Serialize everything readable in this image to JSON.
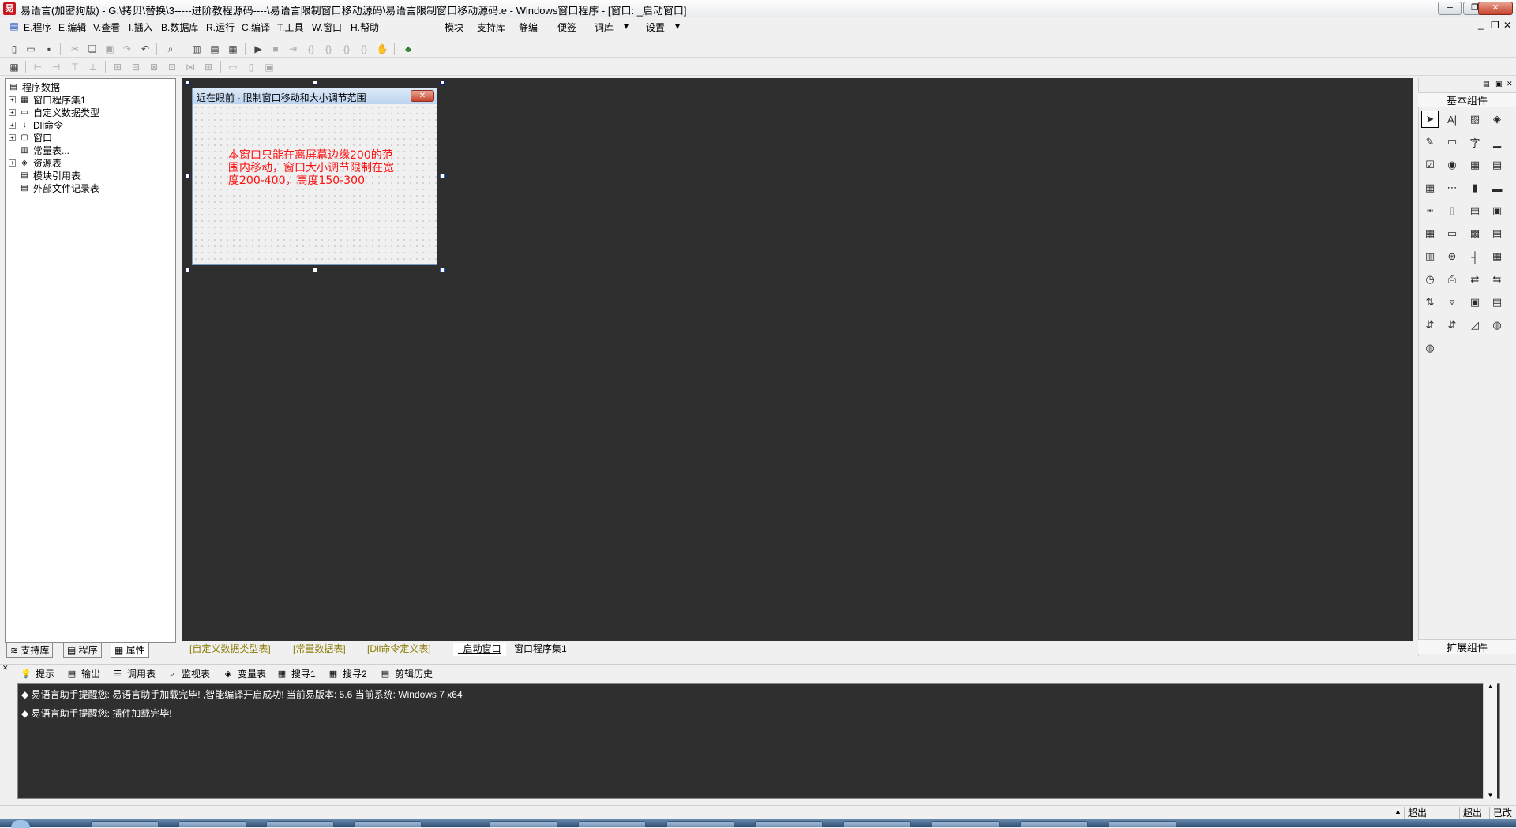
{
  "window": {
    "title": "易语言(加密狗版) - G:\\拷贝\\替换\\3-----进阶教程源码----\\易语言限制窗口移动源码\\易语言限制窗口移动源码.e - Windows窗口程序 - [窗口: _启动窗口]",
    "min_label": "─",
    "max_label": "❐",
    "close_label": "✕"
  },
  "menubar": {
    "items": [
      "E.程序",
      "E.编辑",
      "V.查看",
      "I.插入",
      "B.数据库",
      "R.运行",
      "C.编译",
      "T.工具",
      "W.窗口",
      "H.帮助"
    ],
    "extra": [
      "模块",
      "支持库",
      "静编",
      "便签",
      "词库",
      "设置"
    ],
    "caret": "▾"
  },
  "left_panel": {
    "tree": [
      {
        "label": "程序数据",
        "expander": "",
        "icon": "▤"
      },
      {
        "label": "窗口程序集1",
        "expander": "+",
        "icon": "▦"
      },
      {
        "label": "自定义数据类型",
        "expander": "+",
        "icon": "▭"
      },
      {
        "label": "Dll命令",
        "expander": "+",
        "icon": "↓"
      },
      {
        "label": "窗口",
        "expander": "+",
        "icon": "▢"
      },
      {
        "label": "常量表...",
        "expander": "",
        "icon": "▥"
      },
      {
        "label": "资源表",
        "expander": "+",
        "icon": "◈"
      },
      {
        "label": "模块引用表",
        "expander": "",
        "icon": "▤"
      },
      {
        "label": "外部文件记录表",
        "expander": "",
        "icon": "▤"
      }
    ],
    "tabs": [
      "支持库",
      "程序",
      "属性"
    ]
  },
  "form": {
    "title": "近在眼前 - 限制窗口移动和大小调节范围",
    "close_label": "✕",
    "label_text": "本窗口只能在离屏幕边缘200的范围内移动，窗口大小调节限制在宽度200-400，高度150-300"
  },
  "design_tabs": [
    "[自定义数据类型表]",
    "[常量数据表]",
    "[Dll命令定义表]",
    "_启动窗口",
    "窗口程序集1"
  ],
  "right_panel": {
    "basic_label": "基本组件",
    "ext_label": "扩展组件",
    "components": [
      "➤",
      "A|",
      "▨",
      "◈",
      "✎",
      "▭",
      "字",
      "▁",
      "☑",
      "◉",
      "▦",
      "▤",
      "▦",
      "⋯",
      "▮",
      "▬",
      "┅",
      "▯",
      "▤",
      "▣",
      "▦",
      "▭",
      "▩",
      "▤",
      "▥",
      "⊛",
      "┤",
      "▦",
      "◷",
      "⎙",
      "⇄",
      "⇆",
      "⇅",
      "▿",
      "▣",
      "▤",
      "⇵",
      "⇵",
      "◿",
      "◍",
      "◍"
    ]
  },
  "output_tabs": [
    "提示",
    "输出",
    "调用表",
    "监视表",
    "变量表",
    "搜寻1",
    "搜寻2",
    "剪辑历史"
  ],
  "output_lines": [
    "易语言助手提醒您: 易语言助手加载完毕!  ,智能编译开启成功!  当前易版本: 5.6  当前系统: Windows 7 x64",
    "易语言助手提醒您: 插件加载完毕!"
  ],
  "status": [
    "超出",
    "超出",
    "已改"
  ]
}
